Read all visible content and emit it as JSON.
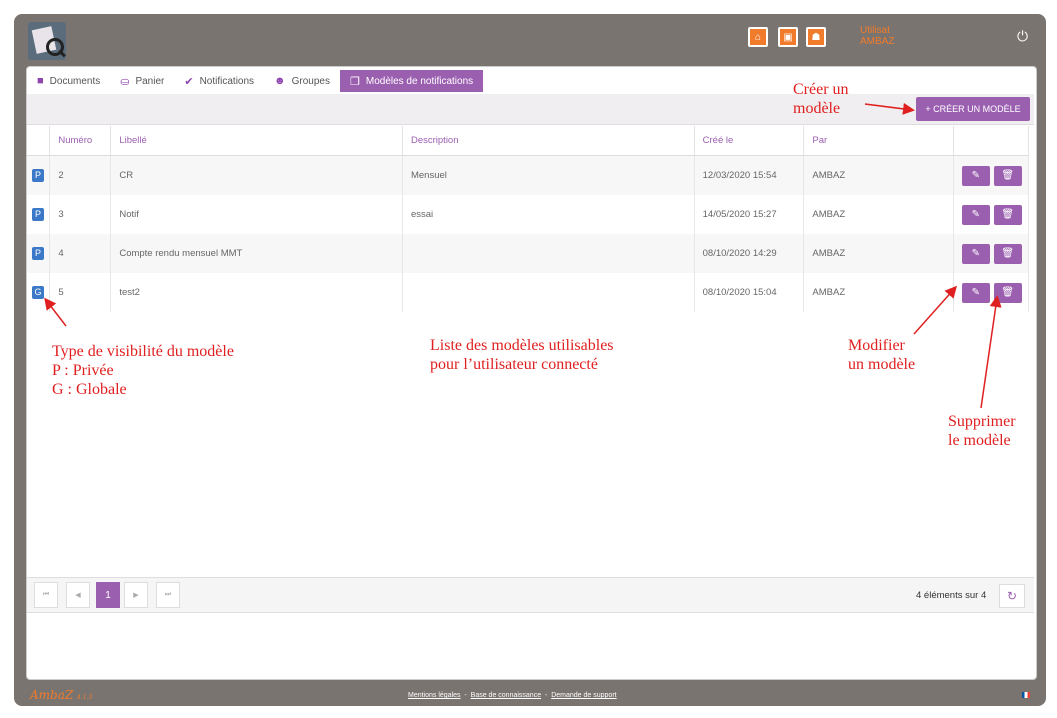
{
  "topbar": {
    "user_line1": "Utilisat",
    "user_line2": "AMBAZ"
  },
  "tabs": [
    {
      "label": "Documents",
      "icon": "folder-icon"
    },
    {
      "label": "Panier",
      "icon": "basket-icon"
    },
    {
      "label": "Notifications",
      "icon": "check-double-icon"
    },
    {
      "label": "Groupes",
      "icon": "users-icon"
    },
    {
      "label": "Modèles de notifications",
      "icon": "copy-icon"
    }
  ],
  "toolbar": {
    "create_label": "+ CRÉER UN MODÈLE"
  },
  "table": {
    "headers": [
      "Numéro",
      "Libellé",
      "Description",
      "Créé le",
      "Par"
    ],
    "rows": [
      {
        "type": "P",
        "numero": "2",
        "libelle": "CR",
        "description": "Mensuel",
        "cree": "12/03/2020 15:54",
        "par": "AMBAZ"
      },
      {
        "type": "P",
        "numero": "3",
        "libelle": "Notif",
        "description": "essai",
        "cree": "14/05/2020 15:27",
        "par": "AMBAZ"
      },
      {
        "type": "P",
        "numero": "4",
        "libelle": "Compte rendu mensuel MMT",
        "description": "",
        "cree": "08/10/2020 14:29",
        "par": "AMBAZ"
      },
      {
        "type": "G",
        "numero": "5",
        "libelle": "test2",
        "description": "",
        "cree": "08/10/2020 15:04",
        "par": "AMBAZ"
      }
    ]
  },
  "pager": {
    "current_page": "1",
    "count_text": "4 éléments sur 4"
  },
  "footer": {
    "brand": "AmbaZ",
    "version": "4.1.3",
    "links": [
      "Mentions légales",
      "Base de connaissance",
      "Demande de support"
    ],
    "sep": "-"
  },
  "annotations": {
    "create": [
      "Créer un",
      "modèle"
    ],
    "visibility": [
      "Type de visibilité du modèle",
      "P : Privée",
      "G : Globale"
    ],
    "list": [
      "Liste des modèles utilisables",
      "pour l’utilisateur connecté"
    ],
    "modify": [
      "Modifier",
      "un modèle"
    ],
    "delete": [
      "Supprimer",
      "le modèle"
    ]
  },
  "colors": {
    "accent": "#9b5fb0",
    "orange": "#f07b2a",
    "annotation": "#e02020",
    "badge": "#3b78c7"
  }
}
